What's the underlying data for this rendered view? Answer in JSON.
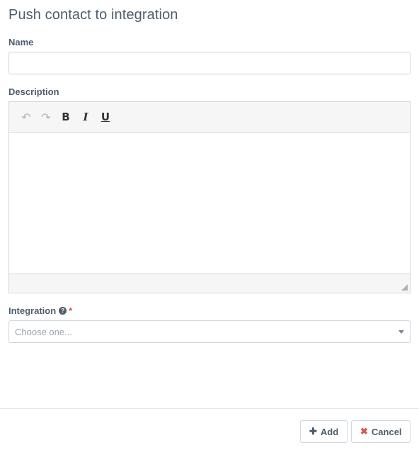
{
  "modal": {
    "title": "Push contact to integration"
  },
  "form": {
    "name_label": "Name",
    "name_value": "",
    "description_label": "Description",
    "integration_label": "Integration",
    "integration_help_icon": "question-circle-icon",
    "integration_required_mark": "*",
    "integration_placeholder": "Choose one..."
  },
  "editor": {
    "toolbar": {
      "undo": "↶",
      "redo": "↷",
      "bold": "B",
      "italic": "I",
      "underline": "U"
    }
  },
  "footer": {
    "add_icon": "✚",
    "add_label": "Add",
    "cancel_icon": "✖",
    "cancel_label": "Cancel"
  },
  "colors": {
    "text": "#4e5d6c",
    "required": "#d9534f",
    "border": "#cfd6de",
    "toolbar_bg": "#f6f6f6"
  }
}
